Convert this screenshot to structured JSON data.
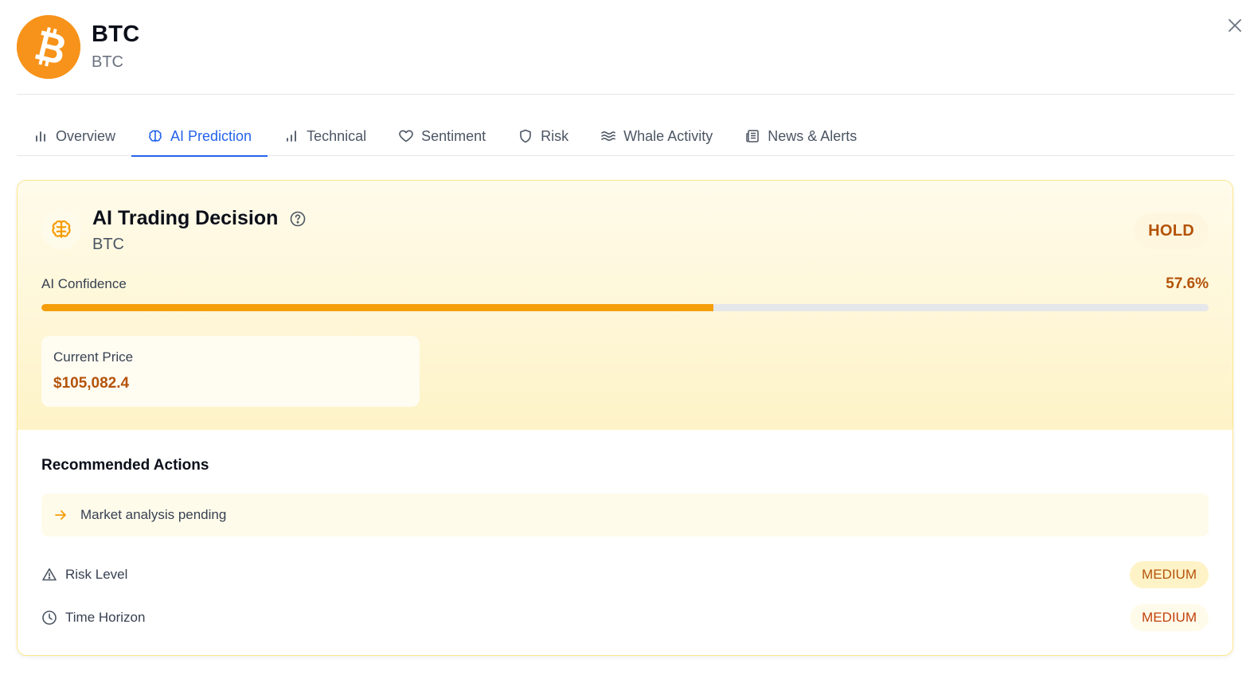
{
  "header": {
    "coin_name": "BTC",
    "coin_symbol": "BTC",
    "logo_icon": "bitcoin-icon",
    "close_icon": "close-icon"
  },
  "tabs": [
    {
      "label": "Overview",
      "icon": "bar-chart-icon"
    },
    {
      "label": "AI Prediction",
      "icon": "brain-icon",
      "active": true
    },
    {
      "label": "Technical",
      "icon": "signal-icon"
    },
    {
      "label": "Sentiment",
      "icon": "heart-icon"
    },
    {
      "label": "Risk",
      "icon": "shield-icon"
    },
    {
      "label": "Whale Activity",
      "icon": "waves-icon"
    },
    {
      "label": "News & Alerts",
      "icon": "newspaper-icon"
    }
  ],
  "decision": {
    "title": "AI Trading Decision",
    "symbol": "BTC",
    "action": "HOLD",
    "confidence_label": "AI Confidence",
    "confidence_text": "57.6%",
    "confidence": 57.6,
    "price_label": "Current Price",
    "price_value": "$105,082.4"
  },
  "recommendations": {
    "title": "Recommended Actions",
    "items": [
      "Market analysis pending"
    ]
  },
  "meta": {
    "risk_label": "Risk Level",
    "risk_value": "MEDIUM",
    "horizon_label": "Time Horizon",
    "horizon_value": "MEDIUM"
  },
  "colors": {
    "accent": "#2563eb",
    "bitcoin": "#f7931a",
    "amber": "#f59e0b",
    "amber_text": "#b45309"
  }
}
